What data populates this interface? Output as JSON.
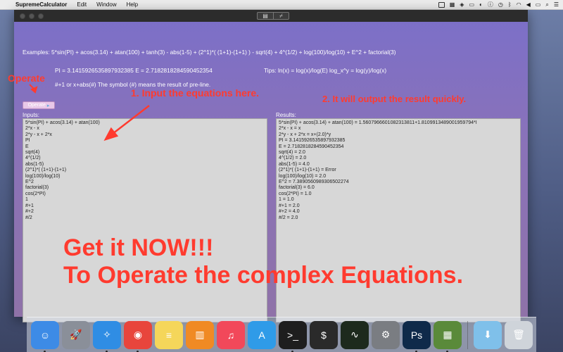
{
  "menubar": {
    "app_name": "SupremeCalculator",
    "items": [
      "Edit",
      "Window",
      "Help"
    ]
  },
  "toolbar": {
    "calculator_icon": "calculator-icon",
    "tool_icon": "tool-icon"
  },
  "info": {
    "examples": "Examples: 5*sin(PI) + acos(3.14) + atan(100) + tanh(3) - abs(1-5) + (2^1)*( (1+1)-(1+1) ) - sqrt(4) + 4^(1/2) + log(100)/log(10) + E^2 + factorial(3)",
    "constants": "PI = 3.1415926535897932385    E = 2.7182818284590452354",
    "tips": "Tips: ln(x) = log(x)/log(E)   log_x^y = log(y)/log(x)",
    "hash_note": "#+1 or x+abs(#)    The symbol (#) means the result of pre-line."
  },
  "operate_button": {
    "label": "Operate"
  },
  "inputs": {
    "label": "Inputs:",
    "lines": [
      "5*sin(PI) + acos(3.14) + atan(100)",
      "2*x - x",
      "2*y - x + 2*x",
      "PI",
      "E",
      "sqrt(4)",
      "4^(1/2)",
      "abs(1-5)",
      "(2^1)*( (1+1)-(1+1)",
      "log(100)/log(10)",
      "E^2",
      "factorial(3)",
      "cos(2*PI)",
      "1",
      "#+1",
      "#+2",
      "#/2"
    ]
  },
  "results": {
    "label": "Results:",
    "lines": [
      "5*sin(PI) + acos(3.14) + atan(100) = 1.5607966601082313811+1.8109913489001959794*I",
      "2*x - x = x",
      "2*y - x + 2*x = x+(2.0)*y",
      "PI = 3.1415926535897932385",
      "E = 2.7182818284590452354",
      "sqrt(4) = 2.0",
      "4^(1/2) = 2.0",
      "abs(1-5) = 4.0",
      "(2^1)*( (1+1)-(1+1) = Error",
      "log(100)/log(10) = 2.0",
      "E^2 = 7.3890560989306502274",
      "factorial(3) = 6.0",
      "cos(2*PI) = 1.0",
      "1 = 1.0",
      "#+1 = 2.0",
      "#+2 = 4.0",
      "#/2 = 2.0"
    ]
  },
  "annotations": {
    "operate": "Operate",
    "input_hint": "1. Input the equations here.",
    "output_hint": "2. It will output the result quickly.",
    "promo_line1": "Get it NOW!!!",
    "promo_line2": "To Operate the complex Equations."
  },
  "colors": {
    "annotation_red": "#ff3b2f",
    "window_purple": "#8a72b8",
    "panel_gray": "#d7d7d7"
  },
  "dock": {
    "apps": [
      {
        "icon": "finder-icon",
        "color": "#3d8be6",
        "running": true
      },
      {
        "icon": "launchpad-icon",
        "color": "#8a8f99",
        "running": false
      },
      {
        "icon": "safari-icon",
        "color": "#2f8de4",
        "running": true
      },
      {
        "icon": "chrome-icon",
        "color": "#e8453c",
        "running": true
      },
      {
        "icon": "notes-icon",
        "color": "#f5d65a",
        "running": false
      },
      {
        "icon": "ibooks-icon",
        "color": "#f08a24",
        "running": false
      },
      {
        "icon": "itunes-icon",
        "color": "#f2485a",
        "running": false
      },
      {
        "icon": "app-store-icon",
        "color": "#2f9be8",
        "running": false
      },
      {
        "icon": "terminal-icon",
        "color": "#1e1e1e",
        "running": true
      },
      {
        "icon": "console-icon",
        "color": "#2a2a2a",
        "running": false
      },
      {
        "icon": "activity-monitor-icon",
        "color": "#1d2a1d",
        "running": false
      },
      {
        "icon": "system-preferences-icon",
        "color": "#7a7d82",
        "running": false
      },
      {
        "icon": "photoshop-icon",
        "color": "#0f2a4a",
        "running": true
      },
      {
        "icon": "supreme-calculator-icon",
        "color": "#5a8a3a",
        "running": true
      }
    ],
    "trailing": [
      {
        "icon": "downloads-folder-icon",
        "color": "#7fc0ea"
      },
      {
        "icon": "trash-icon",
        "color": "#cfd4da"
      }
    ]
  }
}
